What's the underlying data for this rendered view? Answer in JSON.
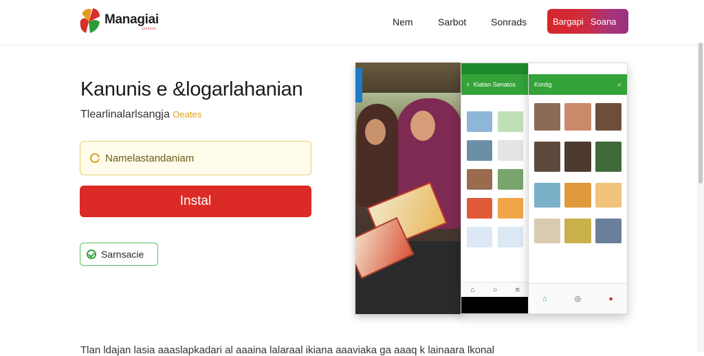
{
  "header": {
    "brand": "Managiai",
    "brand_sub": "xxxxxxx",
    "nav": [
      "Nem",
      "Sarbot",
      "Sonrads"
    ],
    "cta": [
      "Bargapi",
      "Soana"
    ]
  },
  "hero": {
    "headline": "Kanunis e &logarlahanian",
    "subline": "Tlearlinalarlsangja",
    "subline_accent": "Oeates"
  },
  "search": {
    "value": "Namelastandaniam",
    "placeholder": ""
  },
  "install_label": "Instal",
  "secure_label": "Sarnsacie",
  "footer_text": "Tlan ldajan lasia aaaslapkadari al aaaina lalaraal ikiana aaaviaka ga aaaq k lainaara lkonal",
  "phone_left": {
    "appbar": "Kiatan Senatos",
    "back": "‹"
  },
  "phone_right": {
    "appbar": "Kontig"
  }
}
